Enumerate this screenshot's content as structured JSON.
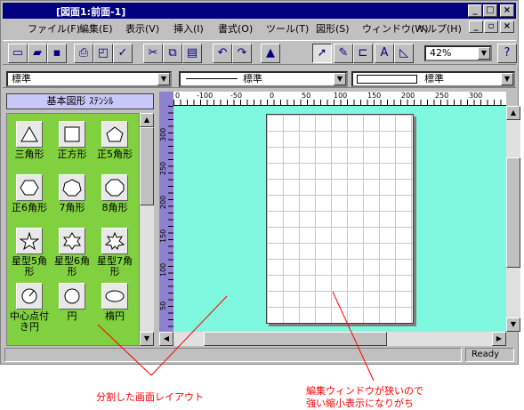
{
  "window": {
    "title": "[図面1:前面-1]",
    "controls": [
      "_",
      "□",
      "×"
    ],
    "doc_controls": [
      "_",
      "▫",
      "×"
    ]
  },
  "menu": [
    "ファイル(F)",
    "編集(E)",
    "表示(V)",
    "挿入(I)",
    "書式(O)",
    "ツール(T)",
    "図形(S)",
    "ウィンドウ(W)",
    "ヘルプ(H)"
  ],
  "toolbar": {
    "zoom": "42%"
  },
  "stylebar": {
    "text_style": "標準",
    "line_style": "標準",
    "fill_style": "標準"
  },
  "stencil": {
    "title": "基本図形 ｽﾃﾝｼﾙ",
    "shapes": [
      {
        "label": "三角形",
        "icon": "triangle-icon"
      },
      {
        "label": "正方形",
        "icon": "square-icon"
      },
      {
        "label": "正5角形",
        "icon": "pentagon-icon"
      },
      {
        "label": "正6角形",
        "icon": "hexagon-icon"
      },
      {
        "label": "7角形",
        "icon": "heptagon-icon"
      },
      {
        "label": "8角形",
        "icon": "octagon-icon"
      },
      {
        "label": "星型5角形",
        "icon": "star5-icon"
      },
      {
        "label": "星型6角形",
        "icon": "star6-icon"
      },
      {
        "label": "星型7角形",
        "icon": "star7-icon"
      },
      {
        "label": "中心点付き円",
        "icon": "circle-center-icon"
      },
      {
        "label": "円",
        "icon": "circle-icon"
      },
      {
        "label": "楕円",
        "icon": "ellipse-icon"
      }
    ]
  },
  "rulers": {
    "h_ticks": [
      "0",
      "-100",
      "-50",
      "0",
      "50",
      "100",
      "150",
      "200",
      "250",
      "300"
    ],
    "v_ticks": [
      "300",
      "250",
      "200",
      "150",
      "100",
      "50"
    ]
  },
  "status": {
    "right": "Ready"
  },
  "annotations": {
    "split_layout": "分割した画面レイアウト",
    "narrow_window_line1": "編集ウィンドウが狭いので",
    "narrow_window_line2": "強い縮小表示になりがち"
  },
  "colors": {
    "titlebar": "#000080",
    "stencil_bg": "#80d040",
    "workspace_bg": "#80f8e0",
    "annotation": "#ff0000"
  }
}
